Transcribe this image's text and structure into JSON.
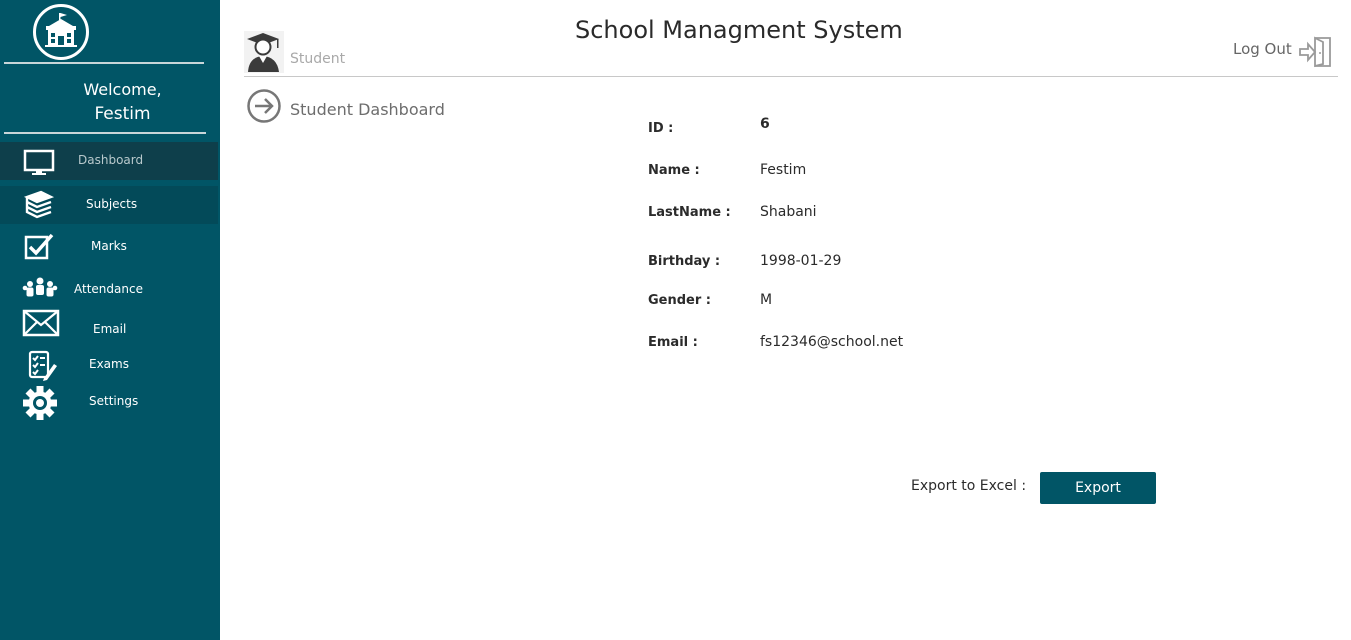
{
  "app": {
    "title": "School Managment System"
  },
  "sidebar": {
    "welcome_line1": "Welcome,",
    "welcome_line2": "Festim",
    "items": [
      {
        "label": "Dashboard",
        "icon": "monitor-icon"
      },
      {
        "label": "Subjects",
        "icon": "books-icon"
      },
      {
        "label": "Marks",
        "icon": "checkbox-icon"
      },
      {
        "label": "Attendance",
        "icon": "group-icon"
      },
      {
        "label": "Email",
        "icon": "envelope-icon"
      },
      {
        "label": "Exams",
        "icon": "checklist-icon"
      },
      {
        "label": "Settings",
        "icon": "gear-icon"
      }
    ]
  },
  "header": {
    "role_label": "Student",
    "logout_label": "Log Out",
    "section_title": "Student Dashboard"
  },
  "student": {
    "id_label": "ID :",
    "id_value": "6",
    "name_label": "Name :",
    "name_value": "Festim",
    "lastname_label": "LastName :",
    "lastname_value": "Shabani",
    "birthday_label": "Birthday :",
    "birthday_value": "1998-01-29",
    "gender_label": "Gender :",
    "gender_value": "M",
    "email_label": "Email :",
    "email_value": "fs12346@school.net"
  },
  "export": {
    "label": "Export to Excel :",
    "button": "Export"
  },
  "colors": {
    "sidebar": "#015566",
    "sidebar_active": "#0e3f4b",
    "accent": "#015566"
  }
}
